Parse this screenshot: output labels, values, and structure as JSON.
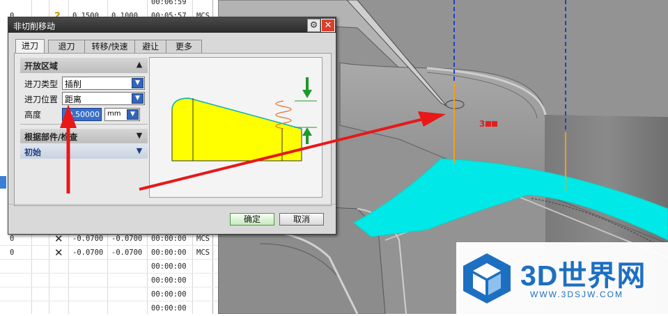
{
  "operation_table": {
    "rows": [
      {
        "order": "",
        "icon": "",
        "value1": "",
        "value2": "",
        "time": "00:06:59",
        "mcs": ""
      },
      {
        "order": "0",
        "icon": "?",
        "value1": "0.1500",
        "value2": "0.1000",
        "time": "00:05:57",
        "mcs": "MCS"
      },
      {
        "order": "0",
        "icon": "✕",
        "value1": "-0.0700",
        "value2": "-0.0700",
        "time": "00:00:00",
        "mcs": "MCS"
      },
      {
        "order": "0",
        "icon": "✕",
        "value1": "-0.0700",
        "value2": "-0.0700",
        "time": "00:00:00",
        "mcs": "MCS"
      },
      {
        "order": "",
        "icon": "",
        "value1": "",
        "value2": "",
        "time": "00:00:00",
        "mcs": ""
      },
      {
        "order": "",
        "icon": "",
        "value1": "",
        "value2": "",
        "time": "00:00:00",
        "mcs": ""
      },
      {
        "order": "",
        "icon": "",
        "value1": "",
        "value2": "",
        "time": "00:00:00",
        "mcs": ""
      },
      {
        "order": "",
        "icon": "",
        "value1": "",
        "value2": "",
        "time": "00:00:00",
        "mcs": ""
      }
    ]
  },
  "dialog": {
    "title": "非切削移动",
    "tabs": [
      "进刀",
      "退刀",
      "转移/快速",
      "避让",
      "更多"
    ],
    "active_tab": "进刀",
    "section_open": "开放区域",
    "fields": {
      "type_label": "进刀类型",
      "type_value": "插削",
      "position_label": "进刀位置",
      "position_value": "距离",
      "height_label": "高度",
      "height_value": "0.50000",
      "height_unit": "mm"
    },
    "section_parts": "根据部件/检查",
    "section_start": "初始",
    "ok_label": "确定",
    "cancel_label": "取消"
  },
  "viewport": {
    "label": "3",
    "label_color": "#e02020",
    "accent_cyan": "#00e8e8",
    "path_orange": "#f0a020",
    "path_blue": "#1a3fd0"
  },
  "watermark": {
    "title": "3D世界网",
    "url": "WWW.3DSJW.COM"
  },
  "colors": {
    "arrow_red": "#e81818",
    "preview_yellow": "#ffff00",
    "preview_green": "#1e9a28"
  }
}
